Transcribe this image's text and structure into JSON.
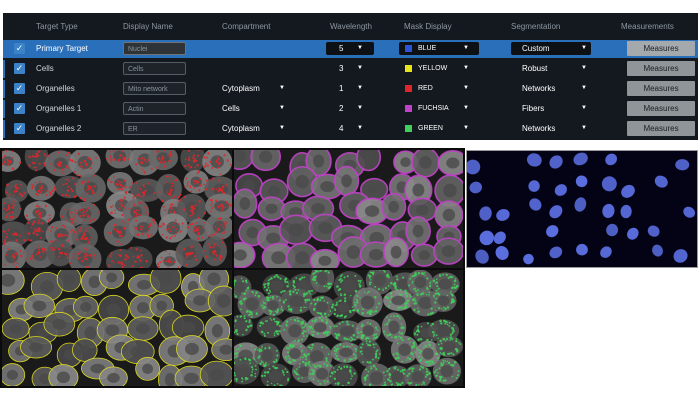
{
  "table": {
    "headers": [
      "Target Type",
      "Display Name",
      "Compartment",
      "Wavelength",
      "Mask Display",
      "Segmentation",
      "Measurements"
    ],
    "rows": [
      {
        "target_type": "Primary Target",
        "display_name": "Nuclei",
        "compartment": "",
        "wavelength": "5",
        "mask_color_name": "BLUE",
        "mask_color": "#2b55d6",
        "segmentation": "Custom",
        "measurements": "Measures",
        "checked": true,
        "selected": true
      },
      {
        "target_type": "Cells",
        "display_name": "Cells",
        "compartment": "",
        "wavelength": "3",
        "mask_color_name": "YELLOW",
        "mask_color": "#e8e41c",
        "segmentation": "Robust",
        "measurements": "Measures",
        "checked": true,
        "selected": false
      },
      {
        "target_type": "Organelles",
        "display_name": "Mito network",
        "compartment": "Cytoplasm",
        "wavelength": "1",
        "mask_color_name": "RED",
        "mask_color": "#e0262b",
        "segmentation": "Networks",
        "measurements": "Measures",
        "checked": true,
        "selected": false
      },
      {
        "target_type": "Organelles 1",
        "display_name": "Actin",
        "compartment": "Cells",
        "wavelength": "2",
        "mask_color_name": "FUCHSIA",
        "mask_color": "#c042c8",
        "segmentation": "Fibers",
        "measurements": "Measures",
        "checked": true,
        "selected": false
      },
      {
        "target_type": "Organelles 2",
        "display_name": "ER",
        "compartment": "Cytoplasm",
        "wavelength": "4",
        "mask_color_name": "GREEN",
        "mask_color": "#3fcf5a",
        "segmentation": "Networks",
        "measurements": "Measures",
        "checked": true,
        "selected": false
      }
    ]
  },
  "icons": {
    "checkbox": "check-icon",
    "dropdown": "caret-down-icon"
  },
  "images": [
    {
      "overlay": "mitochondria red mask overlay",
      "color": "#e0262b"
    },
    {
      "overlay": "actin fuchsia mask overlay",
      "color": "#c042c8"
    },
    {
      "overlay": "nuclei blue staining",
      "color": "#5a6ee0"
    },
    {
      "overlay": "cells yellow outline overlay",
      "color": "#e8e41c"
    },
    {
      "overlay": "ER green mask overlay",
      "color": "#3fcf5a"
    }
  ]
}
